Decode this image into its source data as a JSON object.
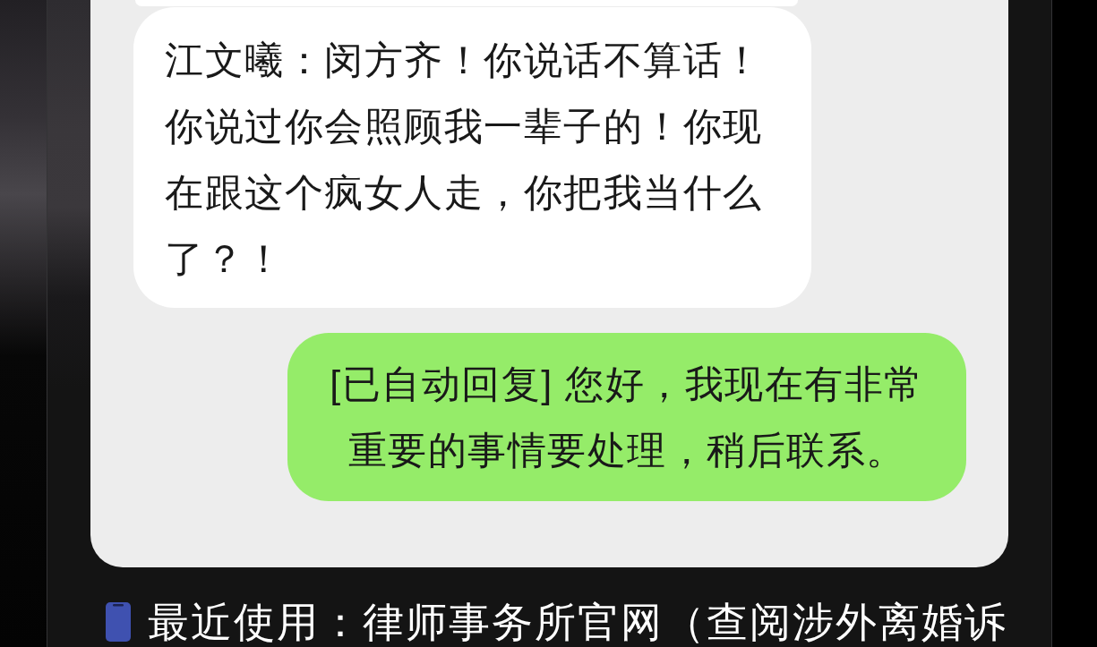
{
  "messages": [
    {
      "kind": "received",
      "text": "江文曦：闵方齐！你说话不算话！你说过你会照顾我一辈子的！你现在跟这个疯女人走，你把我当什么了？！"
    },
    {
      "kind": "sent",
      "text": "[已自动回复] 您好，我现在有非常重要的事情要处理，稍后联系。"
    }
  ],
  "recent_usage": {
    "text": "最近使用：律师事务所官网（查阅涉外离婚诉"
  }
}
